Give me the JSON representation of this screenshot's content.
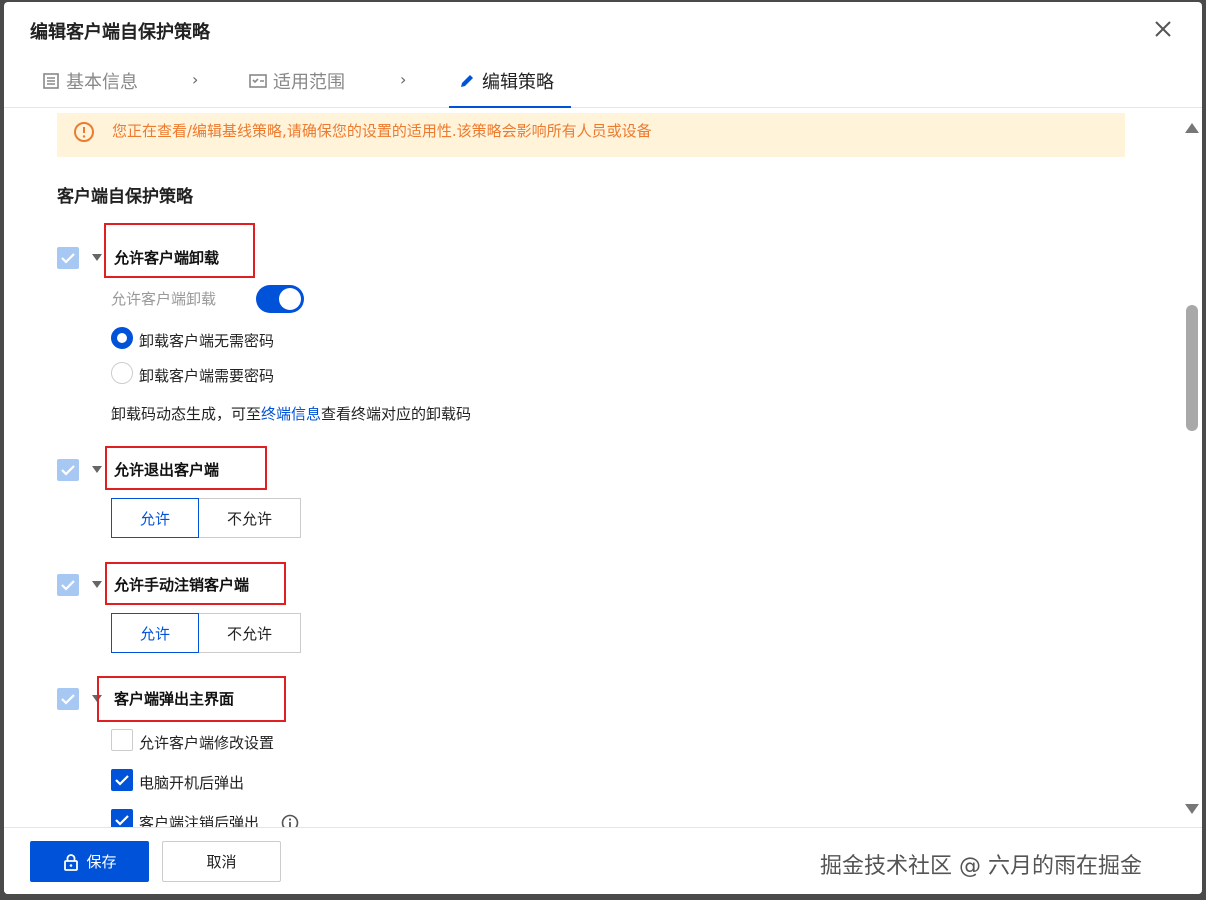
{
  "modal": {
    "title": "编辑客户端自保护策略"
  },
  "steps": [
    {
      "label": "基本信息",
      "icon": "list-icon"
    },
    {
      "label": "适用范围",
      "icon": "checklist-icon"
    },
    {
      "label": "编辑策略",
      "icon": "pencil-icon"
    }
  ],
  "alert": {
    "text": "您正在查看/编辑基线策略,请确保您的设置的适用性.该策略会影响所有人员或设备"
  },
  "section_title": "客户端自保护策略",
  "uninstall": {
    "label": "允许客户端卸载",
    "toggle_label": "允许客户端卸载",
    "toggle_on": true,
    "radio_no_password": "卸载客户端无需密码",
    "radio_need_password": "卸载客户端需要密码",
    "hint_prefix": "卸载码动态生成，可至",
    "hint_link": "终端信息",
    "hint_suffix": "查看终端对应的卸载码"
  },
  "exit": {
    "label": "允许退出客户端",
    "allow": "允许",
    "deny": "不允许"
  },
  "logout": {
    "label": "允许手动注销客户端",
    "allow": "允许",
    "deny": "不允许"
  },
  "popup": {
    "label": "客户端弹出主界面",
    "options": [
      {
        "label": "允许客户端修改设置",
        "checked": false
      },
      {
        "label": "电脑开机后弹出",
        "checked": true
      },
      {
        "label": "客户端注销后弹出",
        "checked": true
      }
    ]
  },
  "footer": {
    "save_label": "保存",
    "cancel_label": "取消",
    "watermark": "掘金技术社区 @ 六月的雨在掘金"
  },
  "colors": {
    "primary": "#0052d9",
    "warning_bg": "#fff3da",
    "warning_text": "#ed7b2f",
    "highlight_box": "#e02020"
  }
}
